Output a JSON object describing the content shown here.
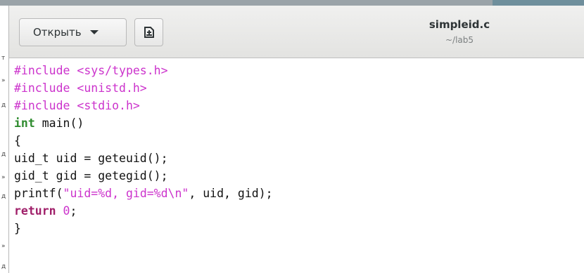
{
  "header": {
    "open_label": "Открыть",
    "title": "simpleid.c",
    "subtitle": "~/lab5"
  },
  "icons": {
    "open_dropdown": "chevron-down-icon",
    "save": "save-document-icon"
  },
  "editor": {
    "lines": [
      [
        {
          "t": "#include <sys/types.h>",
          "c": "pp"
        }
      ],
      [
        {
          "t": "#include <unistd.h>",
          "c": "pp"
        }
      ],
      [
        {
          "t": "#include <stdio.h>",
          "c": "pp"
        }
      ],
      [
        {
          "t": "int",
          "c": "ty"
        },
        {
          "t": " main()",
          "c": ""
        }
      ],
      [
        {
          "t": "{",
          "c": ""
        }
      ],
      [
        {
          "t": "uid_t uid = geteuid();",
          "c": ""
        }
      ],
      [
        {
          "t": "gid_t gid = getegid();",
          "c": ""
        }
      ],
      [
        {
          "t": "printf(",
          "c": ""
        },
        {
          "t": "\"uid=%d, gid=%d\\n\"",
          "c": "str"
        },
        {
          "t": ", uid, gid);",
          "c": ""
        }
      ],
      [
        {
          "t": "return",
          "c": "kw"
        },
        {
          "t": " ",
          "c": ""
        },
        {
          "t": "0",
          "c": "num"
        },
        {
          "t": ";",
          "c": ""
        }
      ],
      [
        {
          "t": "}",
          "c": ""
        }
      ]
    ]
  },
  "colors": {
    "preprocessor": "#cc33cc",
    "keyword": "#a0206a",
    "type": "#2f8c2f",
    "string": "#cc33cc",
    "text": "#111111"
  }
}
